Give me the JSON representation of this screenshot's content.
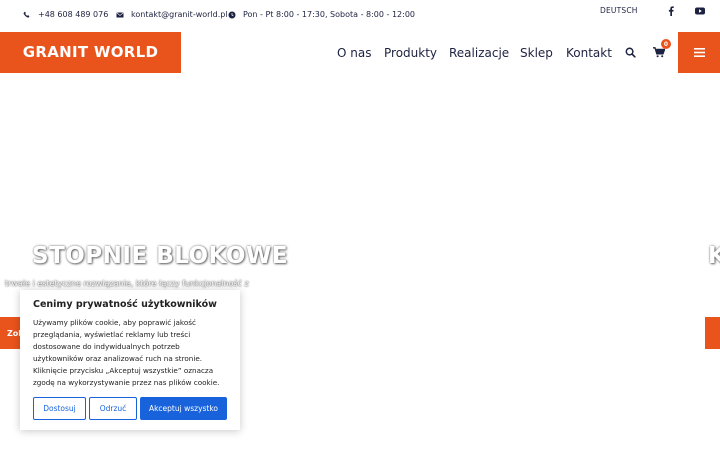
{
  "topbar": {
    "phone": "+48 608 489 076",
    "email": "kontakt@granit-world.pl",
    "hours": "Pon - Pt 8:00 - 17:30, Sobota - 8:00 - 12:00",
    "language": "DEUTSCH",
    "icons": [
      "phone-icon",
      "envelope-icon",
      "clock-icon",
      "facebook-icon",
      "youtube-icon"
    ]
  },
  "header": {
    "logo_text": "GRANIT WORLD",
    "nav": [
      "O nas",
      "Produkty",
      "Realizacje",
      "Sklep",
      "Kontakt"
    ],
    "cart_count": "0",
    "icons": [
      "search-icon",
      "cart-icon",
      "menu-icon"
    ]
  },
  "hero": {
    "title": "STOPNIE BLOKOWE",
    "subtitle": "trwałe i estetyczne rozwiązanie, które łączy funkcjonalność z",
    "button_label": "Zobacz",
    "next_slide_letter": "K"
  },
  "cookie": {
    "title": "Cenimy prywatność użytkowników",
    "text_lines": [
      "Używamy plików cookie, aby poprawić jakość",
      "przeglądania, wyświetlać reklamy lub treści",
      "dostosowane do indywidualnych potrzeb",
      "użytkowników oraz analizować ruch na stronie.",
      "Kliknięcie przycisku „Akceptuj wszystkie” oznacza",
      "zgodę na wykorzystywanie przez nas plików cookie."
    ],
    "customize_label": "Dostosuj",
    "reject_label": "Odrzuć",
    "accept_label": "Akceptuj wszystko"
  },
  "colors": {
    "accent": "#e9531c",
    "navy": "#1d2240",
    "cookie_blue": "#1863dc"
  }
}
